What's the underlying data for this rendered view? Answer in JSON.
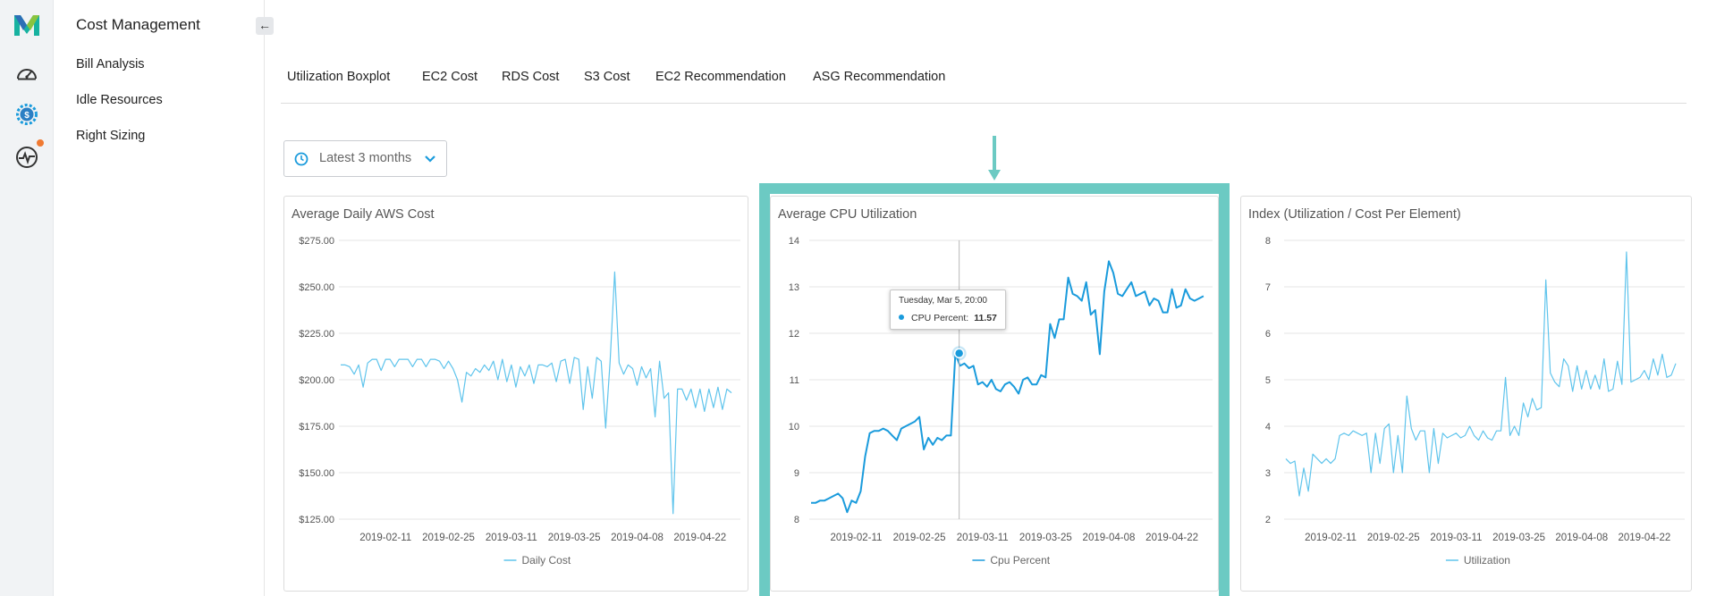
{
  "app": {
    "section_title": "Cost Management",
    "collapse_glyph": "←"
  },
  "rail": {
    "icons": [
      "app-logo",
      "dashboard-gauge-icon",
      "cost-gear-dollar-icon",
      "activity-pulse-icon"
    ],
    "notification_color": "#f07a32"
  },
  "sidebar": {
    "items": [
      {
        "label": "Bill Analysis"
      },
      {
        "label": "Idle Resources"
      },
      {
        "label": "Right Sizing"
      }
    ]
  },
  "tabs": [
    {
      "label": "Utilization Boxplot"
    },
    {
      "label": "EC2 Cost"
    },
    {
      "label": "RDS Cost"
    },
    {
      "label": "S3 Cost"
    },
    {
      "label": "EC2 Recommendation"
    },
    {
      "label": "ASG Recommendation"
    }
  ],
  "range": {
    "label": "Latest 3 months",
    "icon": "clock-icon"
  },
  "colors": {
    "accent": "#1a9bdc",
    "series_light": "#5fc4ec",
    "highlight": "#6ccac3",
    "grid": "#e6e6e6"
  },
  "tooltip": {
    "date": "Tuesday, Mar 5, 20:00",
    "series": "CPU Percent:",
    "value": "11.57"
  },
  "chart_data": [
    {
      "type": "line",
      "title": "Average Daily AWS Cost",
      "x_range": [
        "2019-02-01",
        "2019-05-01"
      ],
      "ylim": [
        125,
        275
      ],
      "ytick_labels": [
        "$275.00",
        "$250.00",
        "$225.00",
        "$200.00",
        "$175.00",
        "$150.00",
        "$125.00"
      ],
      "ytick_values": [
        275,
        250,
        225,
        200,
        175,
        150,
        125
      ],
      "xtick_labels": [
        "2019-02-11",
        "2019-02-25",
        "2019-03-11",
        "2019-03-25",
        "2019-04-08",
        "2019-04-22"
      ],
      "legend": [
        "Daily Cost"
      ],
      "series": [
        {
          "name": "Daily Cost",
          "x": [
            "2019-02-01",
            "2019-02-02",
            "2019-02-03",
            "2019-02-04",
            "2019-02-05",
            "2019-02-06",
            "2019-02-07",
            "2019-02-08",
            "2019-02-09",
            "2019-02-10",
            "2019-02-11",
            "2019-02-12",
            "2019-02-13",
            "2019-02-14",
            "2019-02-15",
            "2019-02-16",
            "2019-02-17",
            "2019-02-18",
            "2019-02-19",
            "2019-02-20",
            "2019-02-21",
            "2019-02-22",
            "2019-02-23",
            "2019-02-24",
            "2019-02-25",
            "2019-02-26",
            "2019-02-27",
            "2019-02-28",
            "2019-03-01",
            "2019-03-02",
            "2019-03-03",
            "2019-03-04",
            "2019-03-05",
            "2019-03-06",
            "2019-03-07",
            "2019-03-08",
            "2019-03-09",
            "2019-03-10",
            "2019-03-11",
            "2019-03-12",
            "2019-03-13",
            "2019-03-14",
            "2019-03-15",
            "2019-03-16",
            "2019-03-17",
            "2019-03-18",
            "2019-03-19",
            "2019-03-20",
            "2019-03-21",
            "2019-03-22",
            "2019-03-23",
            "2019-03-24",
            "2019-03-25",
            "2019-03-26",
            "2019-03-27",
            "2019-03-28",
            "2019-03-29",
            "2019-03-30",
            "2019-03-31",
            "2019-04-01",
            "2019-04-02",
            "2019-04-03",
            "2019-04-04",
            "2019-04-05",
            "2019-04-06",
            "2019-04-07",
            "2019-04-08",
            "2019-04-09",
            "2019-04-10",
            "2019-04-11",
            "2019-04-12",
            "2019-04-13",
            "2019-04-14",
            "2019-04-15",
            "2019-04-16",
            "2019-04-17",
            "2019-04-18",
            "2019-04-19",
            "2019-04-20",
            "2019-04-21",
            "2019-04-22",
            "2019-04-23",
            "2019-04-24",
            "2019-04-25",
            "2019-04-26",
            "2019-04-27",
            "2019-04-28",
            "2019-04-29"
          ],
          "y": [
            208,
            208,
            207,
            203,
            208,
            196,
            209,
            211,
            211,
            205,
            211,
            211,
            207,
            211,
            211,
            211,
            207,
            211,
            211,
            207,
            211,
            211,
            210,
            206,
            210,
            206,
            200,
            188,
            204,
            202,
            206,
            204,
            208,
            205,
            210,
            200,
            211,
            199,
            208,
            196,
            207,
            202,
            208,
            198,
            208,
            208,
            207,
            209,
            199,
            210,
            211,
            198,
            212,
            211,
            184,
            207,
            190,
            212,
            210,
            174,
            210,
            258,
            209,
            203,
            208,
            206,
            197,
            207,
            201,
            206,
            180,
            210,
            190,
            193,
            128,
            195,
            195,
            189,
            195,
            185,
            195,
            183,
            195,
            185,
            196,
            184,
            195,
            193
          ]
        }
      ]
    },
    {
      "type": "line",
      "title": "Average CPU Utilization",
      "x_range": [
        "2019-02-01",
        "2019-05-01"
      ],
      "ylim": [
        8,
        14
      ],
      "ytick_labels": [
        "14",
        "13",
        "12",
        "11",
        "10",
        "9",
        "8"
      ],
      "ytick_values": [
        14,
        13,
        12,
        11,
        10,
        9,
        8
      ],
      "xtick_labels": [
        "2019-02-11",
        "2019-02-25",
        "2019-03-11",
        "2019-03-25",
        "2019-04-08",
        "2019-04-22"
      ],
      "legend": [
        "Cpu Percent"
      ],
      "highlight_point": {
        "x": "2019-03-05T20:00",
        "y": 11.57
      },
      "series": [
        {
          "name": "Cpu Percent",
          "x": [
            "2019-02-01",
            "2019-02-02",
            "2019-02-03",
            "2019-02-04",
            "2019-02-05",
            "2019-02-06",
            "2019-02-07",
            "2019-02-08",
            "2019-02-09",
            "2019-02-10",
            "2019-02-11",
            "2019-02-12",
            "2019-02-13",
            "2019-02-14",
            "2019-02-15",
            "2019-02-16",
            "2019-02-17",
            "2019-02-18",
            "2019-02-19",
            "2019-02-20",
            "2019-02-21",
            "2019-02-22",
            "2019-02-23",
            "2019-02-24",
            "2019-02-25",
            "2019-02-26",
            "2019-02-27",
            "2019-02-28",
            "2019-03-01",
            "2019-03-02",
            "2019-03-03",
            "2019-03-04",
            "2019-03-05",
            "2019-03-06",
            "2019-03-07",
            "2019-03-08",
            "2019-03-09",
            "2019-03-10",
            "2019-03-11",
            "2019-03-12",
            "2019-03-13",
            "2019-03-14",
            "2019-03-15",
            "2019-03-16",
            "2019-03-17",
            "2019-03-18",
            "2019-03-19",
            "2019-03-20",
            "2019-03-21",
            "2019-03-22",
            "2019-03-23",
            "2019-03-24",
            "2019-03-25",
            "2019-03-26",
            "2019-03-27",
            "2019-03-28",
            "2019-03-29",
            "2019-03-30",
            "2019-03-31",
            "2019-04-01",
            "2019-04-02",
            "2019-04-03",
            "2019-04-04",
            "2019-04-05",
            "2019-04-06",
            "2019-04-07",
            "2019-04-08",
            "2019-04-09",
            "2019-04-10",
            "2019-04-11",
            "2019-04-12",
            "2019-04-13",
            "2019-04-14",
            "2019-04-15",
            "2019-04-16",
            "2019-04-17",
            "2019-04-18",
            "2019-04-19",
            "2019-04-20",
            "2019-04-21",
            "2019-04-22",
            "2019-04-23",
            "2019-04-24",
            "2019-04-25",
            "2019-04-26",
            "2019-04-27",
            "2019-04-28",
            "2019-04-29"
          ],
          "y": [
            8.35,
            8.35,
            8.4,
            8.4,
            8.45,
            8.5,
            8.55,
            8.45,
            8.15,
            8.4,
            8.35,
            8.6,
            9.35,
            9.85,
            9.9,
            9.9,
            9.95,
            9.9,
            9.8,
            9.7,
            9.95,
            10.0,
            10.05,
            10.1,
            10.2,
            9.5,
            9.75,
            9.6,
            9.75,
            9.7,
            9.8,
            9.8,
            11.57,
            11.3,
            11.35,
            11.25,
            11.3,
            10.9,
            10.95,
            10.85,
            11.0,
            10.8,
            10.75,
            10.9,
            10.95,
            10.85,
            10.7,
            11.0,
            11.05,
            10.9,
            10.9,
            11.1,
            11.05,
            12.2,
            11.9,
            12.3,
            12.3,
            13.2,
            12.85,
            12.8,
            12.7,
            13.1,
            12.4,
            12.5,
            11.55,
            12.9,
            13.55,
            13.3,
            12.85,
            12.8,
            12.95,
            13.1,
            12.8,
            12.85,
            12.9,
            12.6,
            12.75,
            12.7,
            12.45,
            12.45,
            12.95,
            12.55,
            12.6,
            12.95,
            12.75,
            12.7,
            12.75,
            12.8
          ]
        }
      ]
    },
    {
      "type": "line",
      "title": "Index (Utilization / Cost Per Element)",
      "x_range": [
        "2019-02-01",
        "2019-05-01"
      ],
      "ylim": [
        2,
        8
      ],
      "ytick_labels": [
        "8",
        "7",
        "6",
        "5",
        "4",
        "3",
        "2"
      ],
      "ytick_values": [
        8,
        7,
        6,
        5,
        4,
        3,
        2
      ],
      "xtick_labels": [
        "2019-02-11",
        "2019-02-25",
        "2019-03-11",
        "2019-03-25",
        "2019-04-08",
        "2019-04-22"
      ],
      "legend": [
        "Utilization"
      ],
      "series": [
        {
          "name": "Utilization",
          "x": [
            "2019-02-01",
            "2019-02-02",
            "2019-02-03",
            "2019-02-04",
            "2019-02-05",
            "2019-02-06",
            "2019-02-07",
            "2019-02-08",
            "2019-02-09",
            "2019-02-10",
            "2019-02-11",
            "2019-02-12",
            "2019-02-13",
            "2019-02-14",
            "2019-02-15",
            "2019-02-16",
            "2019-02-17",
            "2019-02-18",
            "2019-02-19",
            "2019-02-20",
            "2019-02-21",
            "2019-02-22",
            "2019-02-23",
            "2019-02-24",
            "2019-02-25",
            "2019-02-26",
            "2019-02-27",
            "2019-02-28",
            "2019-03-01",
            "2019-03-02",
            "2019-03-03",
            "2019-03-04",
            "2019-03-05",
            "2019-03-06",
            "2019-03-07",
            "2019-03-08",
            "2019-03-09",
            "2019-03-10",
            "2019-03-11",
            "2019-03-12",
            "2019-03-13",
            "2019-03-14",
            "2019-03-15",
            "2019-03-16",
            "2019-03-17",
            "2019-03-18",
            "2019-03-19",
            "2019-03-20",
            "2019-03-21",
            "2019-03-22",
            "2019-03-23",
            "2019-03-24",
            "2019-03-25",
            "2019-03-26",
            "2019-03-27",
            "2019-03-28",
            "2019-03-29",
            "2019-03-30",
            "2019-03-31",
            "2019-04-01",
            "2019-04-02",
            "2019-04-03",
            "2019-04-04",
            "2019-04-05",
            "2019-04-06",
            "2019-04-07",
            "2019-04-08",
            "2019-04-09",
            "2019-04-10",
            "2019-04-11",
            "2019-04-12",
            "2019-04-13",
            "2019-04-14",
            "2019-04-15",
            "2019-04-16",
            "2019-04-17",
            "2019-04-18",
            "2019-04-19",
            "2019-04-20",
            "2019-04-21",
            "2019-04-22",
            "2019-04-23",
            "2019-04-24",
            "2019-04-25",
            "2019-04-26",
            "2019-04-27",
            "2019-04-28",
            "2019-04-29"
          ],
          "y": [
            3.3,
            3.2,
            3.25,
            2.5,
            3.1,
            2.6,
            3.4,
            3.3,
            3.2,
            3.3,
            3.2,
            3.3,
            3.8,
            3.85,
            3.8,
            3.9,
            3.85,
            3.8,
            3.85,
            3.0,
            3.85,
            3.2,
            3.95,
            4.05,
            3.0,
            3.8,
            3.0,
            4.65,
            3.95,
            3.7,
            3.9,
            3.9,
            3.0,
            3.95,
            3.2,
            3.85,
            3.75,
            3.8,
            3.85,
            3.75,
            3.8,
            4.0,
            3.8,
            3.7,
            3.9,
            3.75,
            3.7,
            3.9,
            3.9,
            5.05,
            3.8,
            4.0,
            3.8,
            4.5,
            4.2,
            4.6,
            4.35,
            4.4,
            7.15,
            5.15,
            4.95,
            4.85,
            5.45,
            5.3,
            4.75,
            5.3,
            4.8,
            5.2,
            4.8,
            5.1,
            4.8,
            5.45,
            4.75,
            4.8,
            5.4,
            4.9,
            7.75,
            4.95,
            5.0,
            5.05,
            5.2,
            5.0,
            5.45,
            5.1,
            5.55,
            5.05,
            5.1,
            5.35
          ]
        }
      ]
    }
  ]
}
